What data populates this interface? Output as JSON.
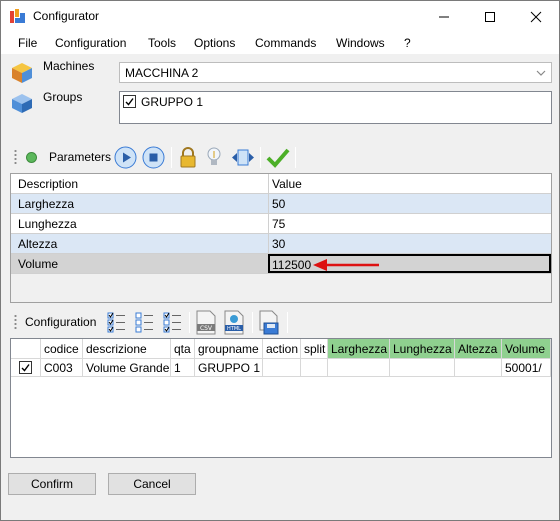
{
  "window": {
    "title": "Configurator",
    "minimize_icon": "minimize-icon",
    "maximize_icon": "maximize-icon",
    "close_icon": "close-icon"
  },
  "menu": {
    "items": [
      "File",
      "Configuration",
      "Tools",
      "Options",
      "Commands",
      "Windows",
      "?"
    ]
  },
  "machines": {
    "label": "Machines",
    "selected": "MACCHINA 2",
    "icon": "machines-icon"
  },
  "groups": {
    "label": "Groups",
    "items": [
      {
        "label": "GRUPPO 1",
        "checked": true
      }
    ],
    "icon": "groups-icon"
  },
  "parameters_toolbar": {
    "label": "Parameters",
    "icons": [
      "status-dot-icon",
      "play-icon",
      "stop-icon",
      "lock-icon",
      "lightbulb-icon",
      "split-icon",
      "checkmark-icon"
    ],
    "status_color": "#5cb85c"
  },
  "parameters_grid": {
    "headers": {
      "description": "Description",
      "value": "Value"
    },
    "rows": [
      {
        "description": "Larghezza",
        "value": "50"
      },
      {
        "description": "Lunghezza",
        "value": "75"
      },
      {
        "description": "Altezza",
        "value": "30"
      },
      {
        "description": "Volume",
        "value": "112500"
      }
    ],
    "annotation": "red-arrow-icon",
    "alt_row_color": "#dbe7f5",
    "selected_row_color": "#d3d3d3"
  },
  "configuration_toolbar": {
    "label": "Configuration",
    "icons": [
      "check-all-icon",
      "uncheck-all-icon",
      "invert-check-icon",
      "csv-export-icon",
      "html-export-icon",
      "save-icon"
    ]
  },
  "configuration_grid": {
    "columns": [
      "",
      "codice",
      "descrizione",
      "qta",
      "groupname",
      "action",
      "split",
      "Larghezza",
      "Lunghezza",
      "Altezza",
      "Volume"
    ],
    "highlight_color": "#8fd08f",
    "rows": [
      {
        "checked": true,
        "codice": "C003",
        "descrizione": "Volume Grande",
        "qta": "1",
        "groupname": "GRUPPO 1",
        "action": "",
        "split": "",
        "larghezza": "",
        "lunghezza": "",
        "altezza": "",
        "volume": "50001/"
      }
    ]
  },
  "buttons": {
    "confirm": "Confirm",
    "cancel": "Cancel"
  }
}
